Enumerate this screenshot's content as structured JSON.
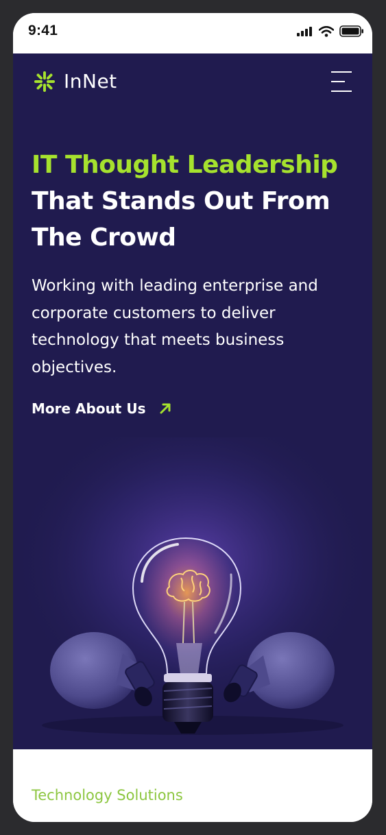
{
  "status_bar": {
    "time": "9:41",
    "icons": [
      "signal-icon",
      "wifi-icon",
      "battery-icon"
    ]
  },
  "header": {
    "logo_text": "InNet",
    "logo_icon": "burst-logo-icon",
    "menu_icon": "hamburger-menu-icon"
  },
  "hero": {
    "headline_accent": "IT Thought Leadership",
    "headline_rest": "That Stands Out From The Crowd",
    "subtext": "Working with leading enterprise and corporate customers to deliver technology that meets business objectives.",
    "cta_label": "More About Us",
    "cta_icon": "arrow-up-right-icon",
    "image": "lightbulb-brain-illustration"
  },
  "next_section": {
    "label": "Technology Solutions"
  },
  "colors": {
    "hero_background": "#201b4f",
    "accent": "#a6e22e",
    "section_label": "#8cc63f",
    "text_light": "#ffffff"
  }
}
